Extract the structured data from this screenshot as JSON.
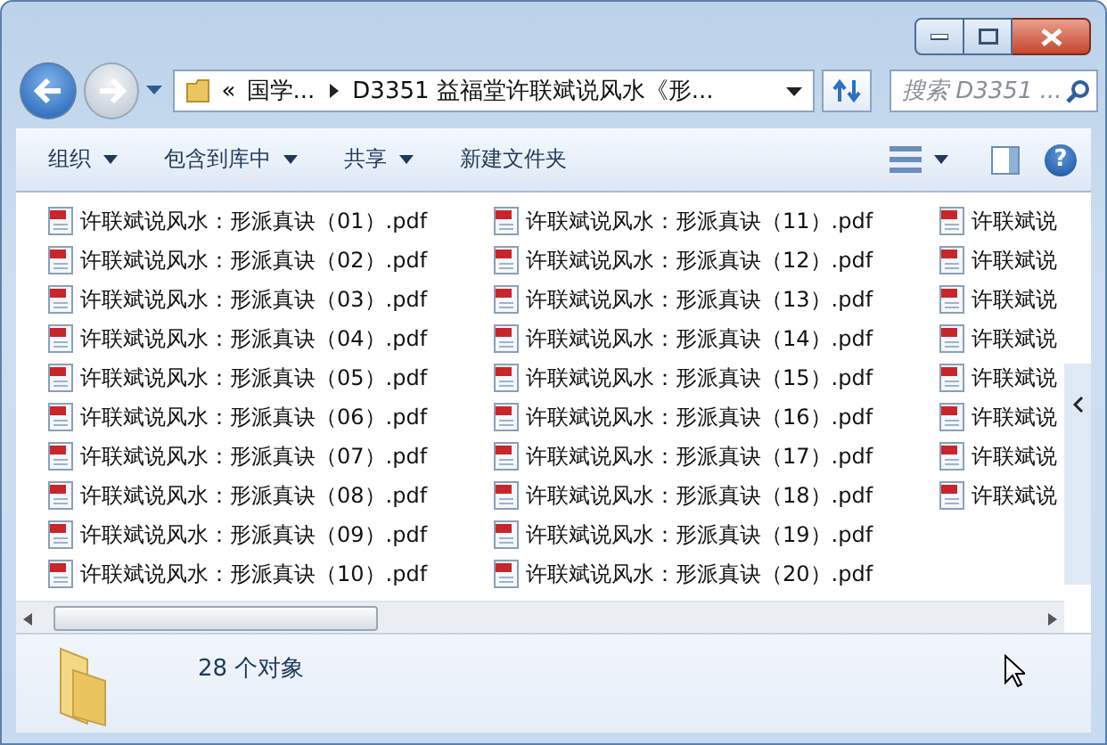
{
  "nav": {
    "back": {
      "disabled": false
    },
    "forward": {
      "disabled": true
    }
  },
  "address": {
    "overflow": "«",
    "crumbs": [
      "国学...",
      "D3351 益福堂许联斌说风水《形..."
    ]
  },
  "search": {
    "placeholder": "搜索 D3351 ..."
  },
  "toolbar": {
    "buttons": [
      {
        "label": "组织",
        "has_menu": true
      },
      {
        "label": "包含到库中",
        "has_menu": true
      },
      {
        "label": "共享",
        "has_menu": true
      },
      {
        "label": "新建文件夹",
        "has_menu": false
      }
    ],
    "help": "?"
  },
  "files": [
    "许联斌说风水：形派真诀（01）.pdf",
    "许联斌说风水：形派真诀（02）.pdf",
    "许联斌说风水：形派真诀（03）.pdf",
    "许联斌说风水：形派真诀（04）.pdf",
    "许联斌说风水：形派真诀（05）.pdf",
    "许联斌说风水：形派真诀（06）.pdf",
    "许联斌说风水：形派真诀（07）.pdf",
    "许联斌说风水：形派真诀（08）.pdf",
    "许联斌说风水：形派真诀（09）.pdf",
    "许联斌说风水：形派真诀（10）.pdf",
    "许联斌说风水：形派真诀（11）.pdf",
    "许联斌说风水：形派真诀（12）.pdf",
    "许联斌说风水：形派真诀（13）.pdf",
    "许联斌说风水：形派真诀（14）.pdf",
    "许联斌说风水：形派真诀（15）.pdf",
    "许联斌说风水：形派真诀（16）.pdf",
    "许联斌说风水：形派真诀（17）.pdf",
    "许联斌说风水：形派真诀（18）.pdf",
    "许联斌说风水：形派真诀（19）.pdf",
    "许联斌说风水：形派真诀（20）.pdf",
    "许联斌说",
    "许联斌说",
    "许联斌说",
    "许联斌说",
    "许联斌说",
    "许联斌说",
    "许联斌说",
    "许联斌说"
  ],
  "status": {
    "count": "28 个对象"
  }
}
